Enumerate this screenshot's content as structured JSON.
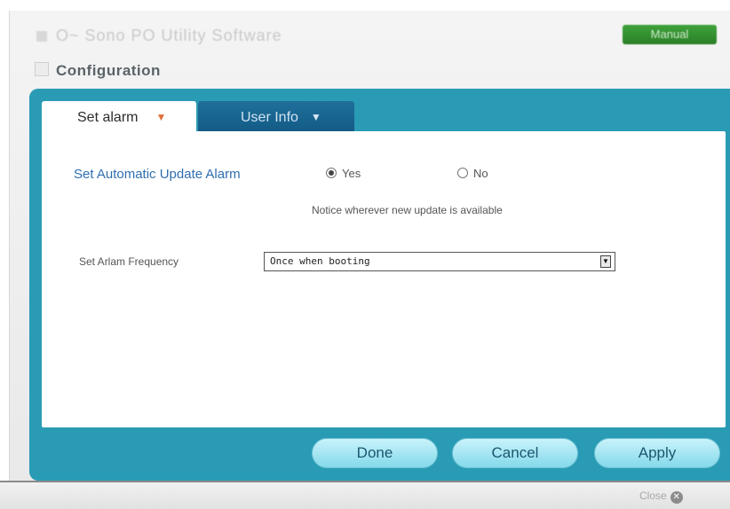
{
  "window": {
    "app_title": "O~ Sono PO Utility Software",
    "manual_label": "Manual",
    "header": "Configuration"
  },
  "tabs": [
    {
      "label": "Set alarm",
      "active": true
    },
    {
      "label": "User Info",
      "active": false
    }
  ],
  "alarm": {
    "label": "Set Automatic Update Alarm",
    "yes_label": "Yes",
    "no_label": "No",
    "selected": "Yes",
    "notice": "Notice wherever new update is available"
  },
  "frequency": {
    "label": "Set Arlam Frequency",
    "value": "Once when booting"
  },
  "buttons": {
    "done": "Done",
    "cancel": "Cancel",
    "apply": "Apply"
  },
  "footer": {
    "close_label": "Close"
  },
  "colors": {
    "panel": "#2a9bb4",
    "active_tab": "#ffffff",
    "inactive_tab": "#135a86",
    "button": "#a8e6f2",
    "label_blue": "#2f6fb0"
  },
  "icons": [
    "dropdown-caret-icon",
    "radio-icon",
    "select-arrow-icon",
    "close-icon"
  ]
}
